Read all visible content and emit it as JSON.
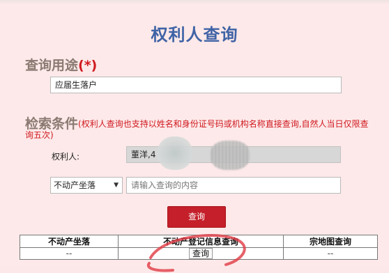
{
  "page": {
    "title": "权利人查询"
  },
  "purpose": {
    "heading": "查询用途",
    "required_mark": "(*)",
    "value": "应届生落户"
  },
  "criteria": {
    "heading": "检索条件",
    "note": "(权利人查询也支持以姓名和身份证号码或机构名称直接查询,自然人当日仅限查询五次)",
    "owner_label": "权利人:",
    "owner_value": "董洋,4",
    "location_select": "不动产坐落",
    "search_placeholder": "请输入查询的内容"
  },
  "actions": {
    "query_label": "查询"
  },
  "results": {
    "columns": [
      "不动产坐落",
      "不动产登记信息查询",
      "宗地图查询"
    ],
    "row": {
      "location": "--",
      "registry_action": "查询",
      "map": "--"
    }
  },
  "colors": {
    "background": "#fde9e9",
    "title": "#3f63a6",
    "accent_red": "#c41f2a",
    "heading_gray": "#8a7a72"
  }
}
